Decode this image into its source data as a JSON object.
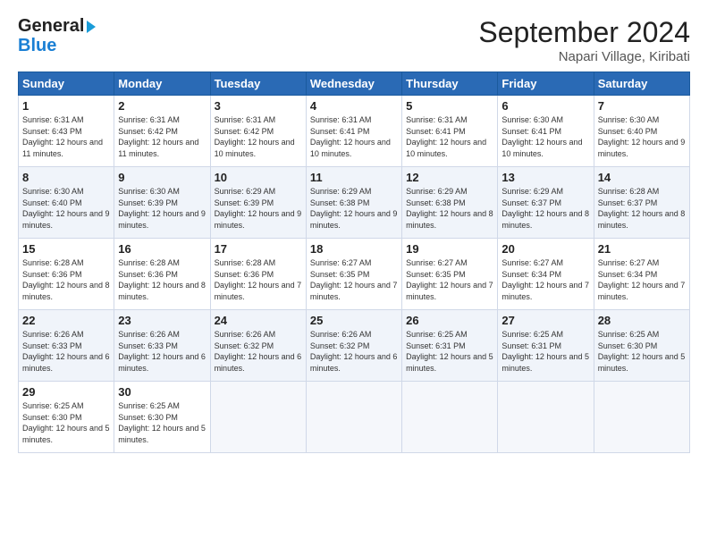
{
  "header": {
    "logo_general": "General",
    "logo_blue": "Blue",
    "title": "September 2024",
    "location": "Napari Village, Kiribati"
  },
  "days_of_week": [
    "Sunday",
    "Monday",
    "Tuesday",
    "Wednesday",
    "Thursday",
    "Friday",
    "Saturday"
  ],
  "weeks": [
    [
      {
        "day": 1,
        "sunrise": "6:31 AM",
        "sunset": "6:43 PM",
        "daylight": "12 hours and 11 minutes."
      },
      {
        "day": 2,
        "sunrise": "6:31 AM",
        "sunset": "6:42 PM",
        "daylight": "12 hours and 11 minutes."
      },
      {
        "day": 3,
        "sunrise": "6:31 AM",
        "sunset": "6:42 PM",
        "daylight": "12 hours and 10 minutes."
      },
      {
        "day": 4,
        "sunrise": "6:31 AM",
        "sunset": "6:41 PM",
        "daylight": "12 hours and 10 minutes."
      },
      {
        "day": 5,
        "sunrise": "6:31 AM",
        "sunset": "6:41 PM",
        "daylight": "12 hours and 10 minutes."
      },
      {
        "day": 6,
        "sunrise": "6:30 AM",
        "sunset": "6:41 PM",
        "daylight": "12 hours and 10 minutes."
      },
      {
        "day": 7,
        "sunrise": "6:30 AM",
        "sunset": "6:40 PM",
        "daylight": "12 hours and 9 minutes."
      }
    ],
    [
      {
        "day": 8,
        "sunrise": "6:30 AM",
        "sunset": "6:40 PM",
        "daylight": "12 hours and 9 minutes."
      },
      {
        "day": 9,
        "sunrise": "6:30 AM",
        "sunset": "6:39 PM",
        "daylight": "12 hours and 9 minutes."
      },
      {
        "day": 10,
        "sunrise": "6:29 AM",
        "sunset": "6:39 PM",
        "daylight": "12 hours and 9 minutes."
      },
      {
        "day": 11,
        "sunrise": "6:29 AM",
        "sunset": "6:38 PM",
        "daylight": "12 hours and 9 minutes."
      },
      {
        "day": 12,
        "sunrise": "6:29 AM",
        "sunset": "6:38 PM",
        "daylight": "12 hours and 8 minutes."
      },
      {
        "day": 13,
        "sunrise": "6:29 AM",
        "sunset": "6:37 PM",
        "daylight": "12 hours and 8 minutes."
      },
      {
        "day": 14,
        "sunrise": "6:28 AM",
        "sunset": "6:37 PM",
        "daylight": "12 hours and 8 minutes."
      }
    ],
    [
      {
        "day": 15,
        "sunrise": "6:28 AM",
        "sunset": "6:36 PM",
        "daylight": "12 hours and 8 minutes."
      },
      {
        "day": 16,
        "sunrise": "6:28 AM",
        "sunset": "6:36 PM",
        "daylight": "12 hours and 8 minutes."
      },
      {
        "day": 17,
        "sunrise": "6:28 AM",
        "sunset": "6:36 PM",
        "daylight": "12 hours and 7 minutes."
      },
      {
        "day": 18,
        "sunrise": "6:27 AM",
        "sunset": "6:35 PM",
        "daylight": "12 hours and 7 minutes."
      },
      {
        "day": 19,
        "sunrise": "6:27 AM",
        "sunset": "6:35 PM",
        "daylight": "12 hours and 7 minutes."
      },
      {
        "day": 20,
        "sunrise": "6:27 AM",
        "sunset": "6:34 PM",
        "daylight": "12 hours and 7 minutes."
      },
      {
        "day": 21,
        "sunrise": "6:27 AM",
        "sunset": "6:34 PM",
        "daylight": "12 hours and 7 minutes."
      }
    ],
    [
      {
        "day": 22,
        "sunrise": "6:26 AM",
        "sunset": "6:33 PM",
        "daylight": "12 hours and 6 minutes."
      },
      {
        "day": 23,
        "sunrise": "6:26 AM",
        "sunset": "6:33 PM",
        "daylight": "12 hours and 6 minutes."
      },
      {
        "day": 24,
        "sunrise": "6:26 AM",
        "sunset": "6:32 PM",
        "daylight": "12 hours and 6 minutes."
      },
      {
        "day": 25,
        "sunrise": "6:26 AM",
        "sunset": "6:32 PM",
        "daylight": "12 hours and 6 minutes."
      },
      {
        "day": 26,
        "sunrise": "6:25 AM",
        "sunset": "6:31 PM",
        "daylight": "12 hours and 5 minutes."
      },
      {
        "day": 27,
        "sunrise": "6:25 AM",
        "sunset": "6:31 PM",
        "daylight": "12 hours and 5 minutes."
      },
      {
        "day": 28,
        "sunrise": "6:25 AM",
        "sunset": "6:30 PM",
        "daylight": "12 hours and 5 minutes."
      }
    ],
    [
      {
        "day": 29,
        "sunrise": "6:25 AM",
        "sunset": "6:30 PM",
        "daylight": "12 hours and 5 minutes."
      },
      {
        "day": 30,
        "sunrise": "6:25 AM",
        "sunset": "6:30 PM",
        "daylight": "12 hours and 5 minutes."
      },
      null,
      null,
      null,
      null,
      null
    ]
  ]
}
